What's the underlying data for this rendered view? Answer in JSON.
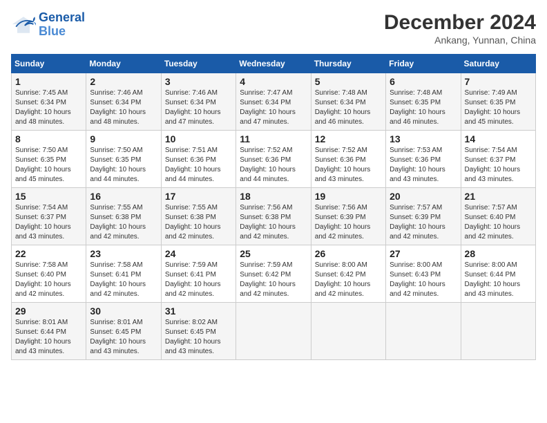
{
  "header": {
    "logo_line1": "General",
    "logo_line2": "Blue",
    "month": "December 2024",
    "location": "Ankang, Yunnan, China"
  },
  "weekdays": [
    "Sunday",
    "Monday",
    "Tuesday",
    "Wednesday",
    "Thursday",
    "Friday",
    "Saturday"
  ],
  "weeks": [
    [
      {
        "day": "1",
        "info": "Sunrise: 7:45 AM\nSunset: 6:34 PM\nDaylight: 10 hours\nand 48 minutes."
      },
      {
        "day": "2",
        "info": "Sunrise: 7:46 AM\nSunset: 6:34 PM\nDaylight: 10 hours\nand 48 minutes."
      },
      {
        "day": "3",
        "info": "Sunrise: 7:46 AM\nSunset: 6:34 PM\nDaylight: 10 hours\nand 47 minutes."
      },
      {
        "day": "4",
        "info": "Sunrise: 7:47 AM\nSunset: 6:34 PM\nDaylight: 10 hours\nand 47 minutes."
      },
      {
        "day": "5",
        "info": "Sunrise: 7:48 AM\nSunset: 6:34 PM\nDaylight: 10 hours\nand 46 minutes."
      },
      {
        "day": "6",
        "info": "Sunrise: 7:48 AM\nSunset: 6:35 PM\nDaylight: 10 hours\nand 46 minutes."
      },
      {
        "day": "7",
        "info": "Sunrise: 7:49 AM\nSunset: 6:35 PM\nDaylight: 10 hours\nand 45 minutes."
      }
    ],
    [
      {
        "day": "8",
        "info": "Sunrise: 7:50 AM\nSunset: 6:35 PM\nDaylight: 10 hours\nand 45 minutes."
      },
      {
        "day": "9",
        "info": "Sunrise: 7:50 AM\nSunset: 6:35 PM\nDaylight: 10 hours\nand 44 minutes."
      },
      {
        "day": "10",
        "info": "Sunrise: 7:51 AM\nSunset: 6:36 PM\nDaylight: 10 hours\nand 44 minutes."
      },
      {
        "day": "11",
        "info": "Sunrise: 7:52 AM\nSunset: 6:36 PM\nDaylight: 10 hours\nand 44 minutes."
      },
      {
        "day": "12",
        "info": "Sunrise: 7:52 AM\nSunset: 6:36 PM\nDaylight: 10 hours\nand 43 minutes."
      },
      {
        "day": "13",
        "info": "Sunrise: 7:53 AM\nSunset: 6:36 PM\nDaylight: 10 hours\nand 43 minutes."
      },
      {
        "day": "14",
        "info": "Sunrise: 7:54 AM\nSunset: 6:37 PM\nDaylight: 10 hours\nand 43 minutes."
      }
    ],
    [
      {
        "day": "15",
        "info": "Sunrise: 7:54 AM\nSunset: 6:37 PM\nDaylight: 10 hours\nand 43 minutes."
      },
      {
        "day": "16",
        "info": "Sunrise: 7:55 AM\nSunset: 6:38 PM\nDaylight: 10 hours\nand 42 minutes."
      },
      {
        "day": "17",
        "info": "Sunrise: 7:55 AM\nSunset: 6:38 PM\nDaylight: 10 hours\nand 42 minutes."
      },
      {
        "day": "18",
        "info": "Sunrise: 7:56 AM\nSunset: 6:38 PM\nDaylight: 10 hours\nand 42 minutes."
      },
      {
        "day": "19",
        "info": "Sunrise: 7:56 AM\nSunset: 6:39 PM\nDaylight: 10 hours\nand 42 minutes."
      },
      {
        "day": "20",
        "info": "Sunrise: 7:57 AM\nSunset: 6:39 PM\nDaylight: 10 hours\nand 42 minutes."
      },
      {
        "day": "21",
        "info": "Sunrise: 7:57 AM\nSunset: 6:40 PM\nDaylight: 10 hours\nand 42 minutes."
      }
    ],
    [
      {
        "day": "22",
        "info": "Sunrise: 7:58 AM\nSunset: 6:40 PM\nDaylight: 10 hours\nand 42 minutes."
      },
      {
        "day": "23",
        "info": "Sunrise: 7:58 AM\nSunset: 6:41 PM\nDaylight: 10 hours\nand 42 minutes."
      },
      {
        "day": "24",
        "info": "Sunrise: 7:59 AM\nSunset: 6:41 PM\nDaylight: 10 hours\nand 42 minutes."
      },
      {
        "day": "25",
        "info": "Sunrise: 7:59 AM\nSunset: 6:42 PM\nDaylight: 10 hours\nand 42 minutes."
      },
      {
        "day": "26",
        "info": "Sunrise: 8:00 AM\nSunset: 6:42 PM\nDaylight: 10 hours\nand 42 minutes."
      },
      {
        "day": "27",
        "info": "Sunrise: 8:00 AM\nSunset: 6:43 PM\nDaylight: 10 hours\nand 42 minutes."
      },
      {
        "day": "28",
        "info": "Sunrise: 8:00 AM\nSunset: 6:44 PM\nDaylight: 10 hours\nand 43 minutes."
      }
    ],
    [
      {
        "day": "29",
        "info": "Sunrise: 8:01 AM\nSunset: 6:44 PM\nDaylight: 10 hours\nand 43 minutes."
      },
      {
        "day": "30",
        "info": "Sunrise: 8:01 AM\nSunset: 6:45 PM\nDaylight: 10 hours\nand 43 minutes."
      },
      {
        "day": "31",
        "info": "Sunrise: 8:02 AM\nSunset: 6:45 PM\nDaylight: 10 hours\nand 43 minutes."
      },
      {
        "day": "",
        "info": ""
      },
      {
        "day": "",
        "info": ""
      },
      {
        "day": "",
        "info": ""
      },
      {
        "day": "",
        "info": ""
      }
    ]
  ]
}
